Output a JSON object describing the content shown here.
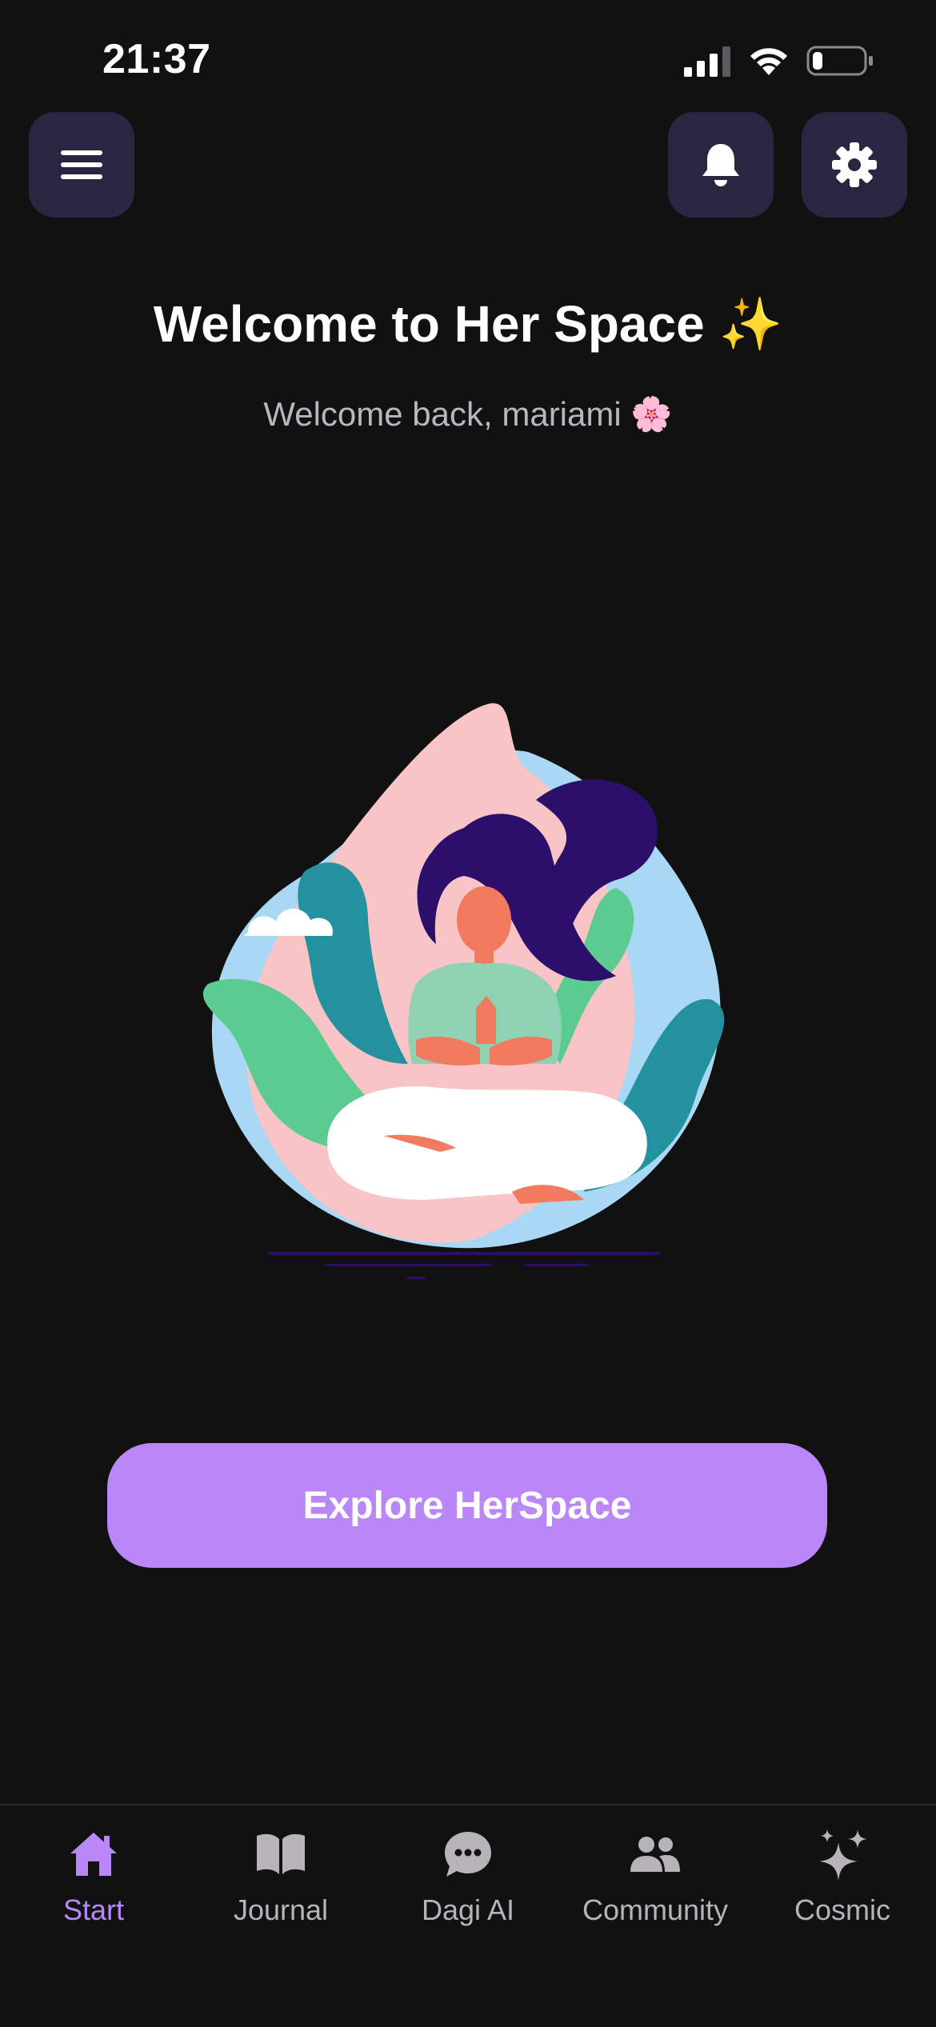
{
  "status_bar": {
    "time": "21:37",
    "signal_icon": "cellular-signal-icon",
    "wifi_icon": "wifi-icon",
    "battery_icon": "battery-icon",
    "battery_level": 0.2
  },
  "header": {
    "menu_icon": "hamburger-menu-icon",
    "notification_icon": "bell-icon",
    "settings_icon": "gear-icon"
  },
  "welcome": {
    "title": "Welcome to Her Space ✨",
    "subtitle": "Welcome back, mariami 🌸"
  },
  "hero": {
    "illustration": "meditating-woman-illustration"
  },
  "cta": {
    "label": "Explore HerSpace"
  },
  "bottom_nav": {
    "items": [
      {
        "label": "Start",
        "icon": "home-icon",
        "active": true
      },
      {
        "label": "Journal",
        "icon": "book-icon",
        "active": false
      },
      {
        "label": "Dagi AI",
        "icon": "chat-bubble-icon",
        "active": false
      },
      {
        "label": "Community",
        "icon": "people-icon",
        "active": false
      },
      {
        "label": "Cosmic",
        "icon": "sparkles-icon",
        "active": false
      }
    ]
  },
  "colors": {
    "background": "#121112",
    "accent": "#b987f7",
    "button_surface": "#2a2540",
    "muted_text": "#b6b4b9"
  }
}
